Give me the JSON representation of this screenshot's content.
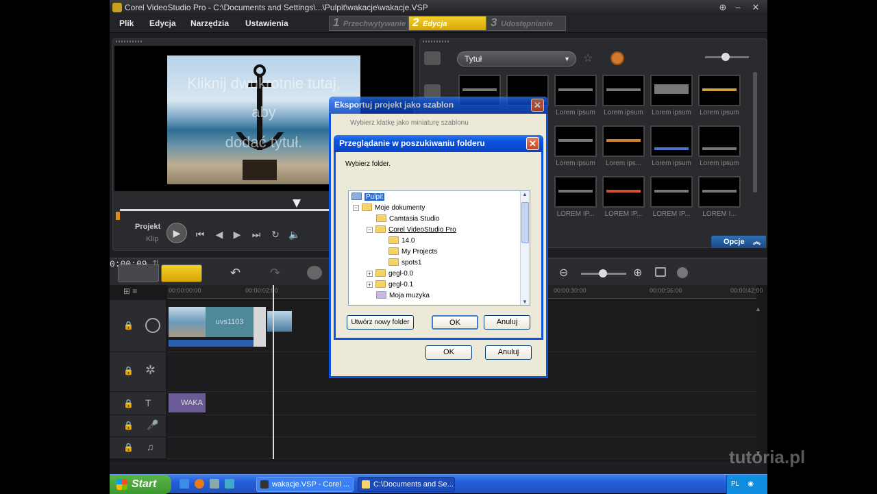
{
  "window": {
    "title": "Corel VideoStudio Pro - C:\\Documents and Settings\\...\\Pulpit\\wakacje\\wakacje.VSP"
  },
  "menu": [
    "Plik",
    "Edycja",
    "Narzędzia",
    "Ustawienia"
  ],
  "steps": [
    {
      "num": "1",
      "label": "Przechwytywanie"
    },
    {
      "num": "2",
      "label": "Edycja"
    },
    {
      "num": "3",
      "label": "Udostępnianie"
    }
  ],
  "preview": {
    "overlay_lines": [
      "Kliknij dwukrotnie tutaj,",
      "aby",
      "dodać tytuł."
    ],
    "project_label": "Projekt",
    "clip_label": "Klip"
  },
  "library": {
    "dropdown": "Tytuł",
    "options_button": "Opcje",
    "thumb_labels": [
      "",
      "",
      "Lorem ipsum",
      "Lorem ipsum",
      "Lorem ipsum",
      "Lorem ipsum",
      "",
      "",
      "Lorem ipsum",
      "Lorem ips...",
      "Lorem ipsum",
      "Lorem ipsum",
      "",
      "",
      "LOREM IP...",
      "LOREM IP...",
      "LOREM IP...",
      "LOREM I..."
    ]
  },
  "timeline": {
    "timecode": "0:00:09",
    "ruler": [
      "00:00:00:00",
      "00:00:02:00",
      "00:00:30:00",
      "00:00:36:00",
      "00:00:42:00"
    ],
    "video_clip_label": "uvs1103",
    "title_clip_label": "WAKA"
  },
  "export_dialog": {
    "title": "Eksportuj projekt jako szablon",
    "instruction": "Wybierz klatkę jako miniaturę szablonu",
    "ok": "OK",
    "cancel": "Anuluj"
  },
  "browse_dialog": {
    "title": "Przeglądanie w poszukiwaniu folderu",
    "prompt": "Wybierz folder.",
    "tree": [
      "Pulpit",
      "Moje dokumenty",
      "Camtasia Studio",
      "Corel VideoStudio Pro",
      "14.0",
      "My Projects",
      "spots1",
      "gegl-0.0",
      "gegl-0.1",
      "Moja muzyka"
    ],
    "new_folder": "Utwórz nowy folder",
    "ok": "OK",
    "cancel": "Anuluj"
  },
  "taskbar": {
    "start": "Start",
    "buttons": [
      "wakacje.VSP - Corel ...",
      "C:\\Documents and Se..."
    ],
    "lang": "PL"
  },
  "watermark": "tutoria.pl",
  "colors": {
    "accent": "#e2b80f",
    "xp_blue": "#0a54e3",
    "selection": "#316ac5"
  }
}
